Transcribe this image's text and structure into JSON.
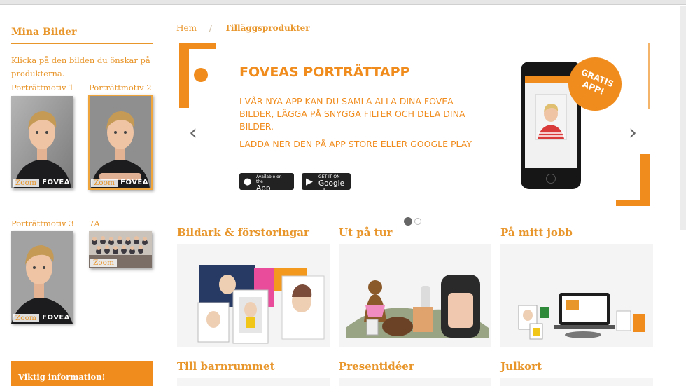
{
  "sidebar": {
    "title": "Mina Bilder",
    "help": "Klicka på den bilden du önskar på produkterna.",
    "photos": [
      {
        "label": "Porträttmotiv 1",
        "zoom": "Zoom",
        "watermark": "FOVEA",
        "selected": false
      },
      {
        "label": "Porträttmotiv 2",
        "zoom": "Zoom",
        "watermark": "FOVEA",
        "selected": true
      },
      {
        "label": "Porträttmotiv 3",
        "zoom": "Zoom",
        "watermark": "FOVEA",
        "selected": false
      },
      {
        "label": "7A",
        "zoom": "Zoom",
        "watermark": "",
        "selected": false
      }
    ],
    "info_button": "Viktig information!"
  },
  "breadcrumb": {
    "home": "Hem",
    "separator": "/",
    "current": "Tilläggsprodukter"
  },
  "banner": {
    "title": "FOVEAS PORTRÄTTAPP",
    "text": "I VÅR NYA APP KAN DU SAMLA ALLA DINA FOVEA-BILDER, LÄGGA PÅ SNYGGA FILTER OCH DELA DINA BILDER.",
    "text2": "LADDA NER DEN PÅ APP STORE ELLER GOOGLE PLAY",
    "appstore_small": "Available on the",
    "appstore_big": "App Store",
    "google_small": "GET IT ON",
    "google_big": "Google play",
    "badge": "GRATIS APP!",
    "prev_arrow": "‹",
    "next_arrow": "›",
    "slide_count": 2,
    "active_slide": 1
  },
  "categories": [
    {
      "title": "Bildark & förstoringar"
    },
    {
      "title": "Ut på tur"
    },
    {
      "title": "På mitt jobb"
    },
    {
      "title": "Till barnrummet"
    },
    {
      "title": "Presentidéer"
    },
    {
      "title": "Julkort"
    }
  ],
  "colors": {
    "accent": "#f08c1d",
    "text": "#e8952a"
  }
}
